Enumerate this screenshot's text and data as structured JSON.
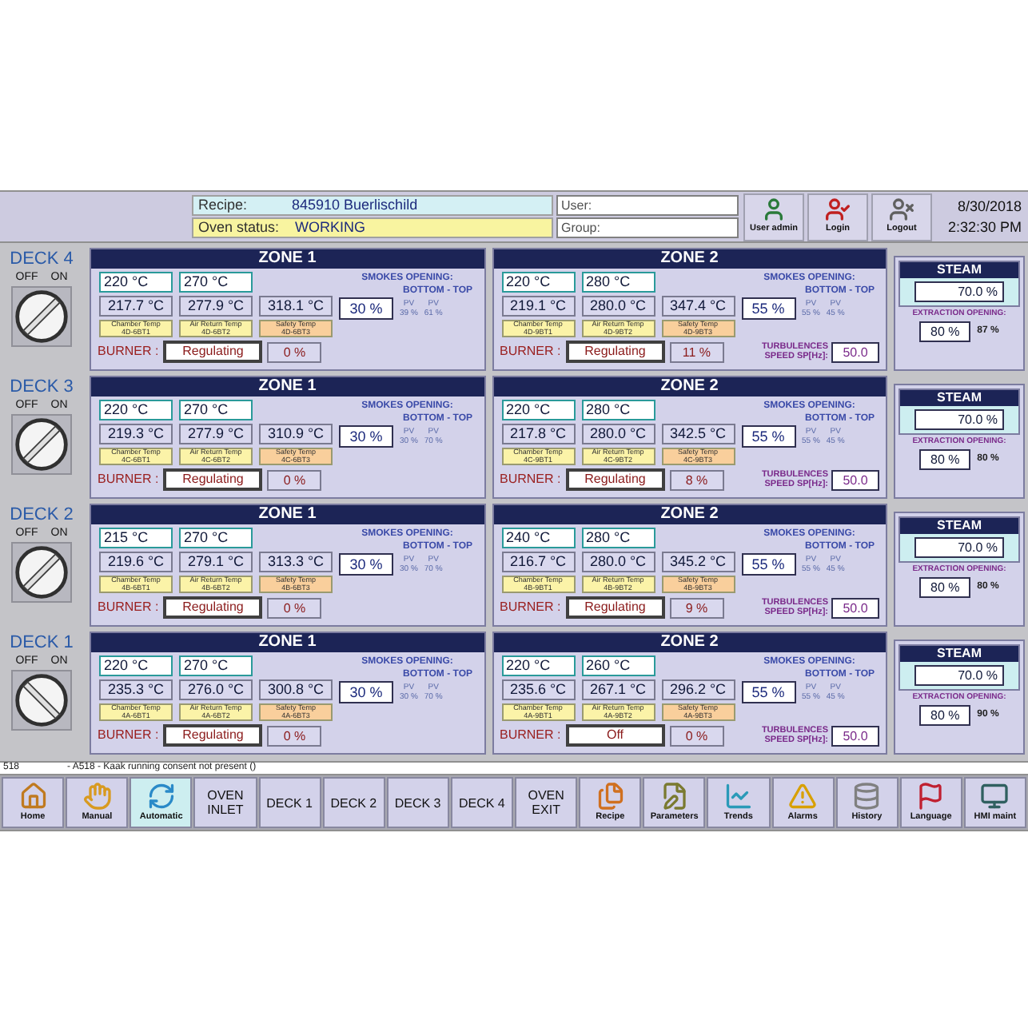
{
  "header": {
    "recipe_label": "Recipe:",
    "recipe": "845910 Buerlischild",
    "status_label": "Oven status:",
    "status": "WORKING",
    "user_label": "User:",
    "group_label": "Group:",
    "buttons": [
      {
        "kind": "user",
        "label": "User admin"
      },
      {
        "kind": "login",
        "label": "Login"
      },
      {
        "kind": "logout",
        "label": "Logout"
      }
    ],
    "date": "8/30/2018",
    "time": "2:32:30 PM"
  },
  "decks": [
    {
      "label": "DECK 4",
      "off_label": "OFF",
      "on_label": "ON",
      "on": true,
      "zones": [
        {
          "title": "ZONE 1",
          "setpoints": [
            "220 °C",
            "270 °C"
          ],
          "actuals": [
            "217.7 °C",
            "277.9 °C",
            "318.1 °C"
          ],
          "sensors": [
            {
              "name": "Chamber Temp",
              "tag": "4D-6BT1",
              "kind": "process"
            },
            {
              "name": "Air Return Temp",
              "tag": "4D-6BT2",
              "kind": "process"
            },
            {
              "name": "Safety Temp",
              "tag": "4D-6BT3",
              "kind": "safety"
            }
          ],
          "smokes_label": "SMOKES OPENING:",
          "bottom_top": "BOTTOM - TOP",
          "smoke_sp": "30 %",
          "pv_labels": [
            "PV",
            "PV"
          ],
          "pv_values": [
            "39 %",
            "61 %"
          ],
          "burner_label": "BURNER :",
          "burner_state": "Regulating",
          "burner_pct": "0 %"
        },
        {
          "title": "ZONE 2",
          "setpoints": [
            "220 °C",
            "280 °C"
          ],
          "actuals": [
            "219.1 °C",
            "280.0 °C",
            "347.4 °C"
          ],
          "sensors": [
            {
              "name": "Chamber Temp",
              "tag": "4D-9BT1",
              "kind": "process"
            },
            {
              "name": "Air Return Temp",
              "tag": "4D-9BT2",
              "kind": "process"
            },
            {
              "name": "Safety Temp",
              "tag": "4D-9BT3",
              "kind": "safety"
            }
          ],
          "smokes_label": "SMOKES OPENING:",
          "bottom_top": "BOTTOM - TOP",
          "smoke_sp": "55 %",
          "pv_labels": [
            "PV",
            "PV"
          ],
          "pv_values": [
            "55 %",
            "45 %"
          ],
          "burner_label": "BURNER :",
          "burner_state": "Regulating",
          "burner_pct": "11 %",
          "turbulence_label": [
            "TURBULENCES",
            "SPEED SP[Hz]:"
          ],
          "turbulence": "50.0"
        }
      ],
      "steam": {
        "title": "STEAM",
        "value": "70.0 %",
        "extraction_label": "EXTRACTION OPENING:",
        "extraction_sp": "80 %",
        "extraction_pv": "87 %"
      }
    },
    {
      "label": "DECK 3",
      "off_label": "OFF",
      "on_label": "ON",
      "on": true,
      "zones": [
        {
          "title": "ZONE 1",
          "setpoints": [
            "220 °C",
            "270 °C"
          ],
          "actuals": [
            "219.3 °C",
            "277.9 °C",
            "310.9 °C"
          ],
          "sensors": [
            {
              "name": "Chamber Temp",
              "tag": "4C-6BT1",
              "kind": "process"
            },
            {
              "name": "Air Return Temp",
              "tag": "4C-6BT2",
              "kind": "process"
            },
            {
              "name": "Safety Temp",
              "tag": "4C-6BT3",
              "kind": "safety"
            }
          ],
          "smokes_label": "SMOKES OPENING:",
          "bottom_top": "BOTTOM - TOP",
          "smoke_sp": "30 %",
          "pv_labels": [
            "PV",
            "PV"
          ],
          "pv_values": [
            "30 %",
            "70 %"
          ],
          "burner_label": "BURNER :",
          "burner_state": "Regulating",
          "burner_pct": "0 %"
        },
        {
          "title": "ZONE 2",
          "setpoints": [
            "220 °C",
            "280 °C"
          ],
          "actuals": [
            "217.8 °C",
            "280.0 °C",
            "342.5 °C"
          ],
          "sensors": [
            {
              "name": "Chamber Temp",
              "tag": "4C-9BT1",
              "kind": "process"
            },
            {
              "name": "Air Return Temp",
              "tag": "4C-9BT2",
              "kind": "process"
            },
            {
              "name": "Safety Temp",
              "tag": "4C-9BT3",
              "kind": "safety"
            }
          ],
          "smokes_label": "SMOKES OPENING:",
          "bottom_top": "BOTTOM - TOP",
          "smoke_sp": "55 %",
          "pv_labels": [
            "PV",
            "PV"
          ],
          "pv_values": [
            "55 %",
            "45 %"
          ],
          "burner_label": "BURNER :",
          "burner_state": "Regulating",
          "burner_pct": "8 %",
          "turbulence_label": [
            "TURBULENCES",
            "SPEED SP[Hz]:"
          ],
          "turbulence": "50.0"
        }
      ],
      "steam": {
        "title": "STEAM",
        "value": "70.0 %",
        "extraction_label": "EXTRACTION OPENING:",
        "extraction_sp": "80 %",
        "extraction_pv": "80 %"
      }
    },
    {
      "label": "DECK 2",
      "off_label": "OFF",
      "on_label": "ON",
      "on": true,
      "zones": [
        {
          "title": "ZONE 1",
          "setpoints": [
            "215 °C",
            "270 °C"
          ],
          "actuals": [
            "219.6 °C",
            "279.1 °C",
            "313.3 °C"
          ],
          "sensors": [
            {
              "name": "Chamber Temp",
              "tag": "4B-6BT1",
              "kind": "process"
            },
            {
              "name": "Air Return Temp",
              "tag": "4B-6BT2",
              "kind": "process"
            },
            {
              "name": "Safety Temp",
              "tag": "4B-6BT3",
              "kind": "safety"
            }
          ],
          "smokes_label": "SMOKES OPENING:",
          "bottom_top": "BOTTOM - TOP",
          "smoke_sp": "30 %",
          "pv_labels": [
            "PV",
            "PV"
          ],
          "pv_values": [
            "30 %",
            "70 %"
          ],
          "burner_label": "BURNER :",
          "burner_state": "Regulating",
          "burner_pct": "0 %"
        },
        {
          "title": "ZONE 2",
          "setpoints": [
            "240 °C",
            "280 °C"
          ],
          "actuals": [
            "216.7 °C",
            "280.0 °C",
            "345.2 °C"
          ],
          "sensors": [
            {
              "name": "Chamber Temp",
              "tag": "4B-9BT1",
              "kind": "process"
            },
            {
              "name": "Air Return Temp",
              "tag": "4B-9BT2",
              "kind": "process"
            },
            {
              "name": "Safety Temp",
              "tag": "4B-9BT3",
              "kind": "safety"
            }
          ],
          "smokes_label": "SMOKES OPENING:",
          "bottom_top": "BOTTOM - TOP",
          "smoke_sp": "55 %",
          "pv_labels": [
            "PV",
            "PV"
          ],
          "pv_values": [
            "55 %",
            "45 %"
          ],
          "burner_label": "BURNER :",
          "burner_state": "Regulating",
          "burner_pct": "9 %",
          "turbulence_label": [
            "TURBULENCES",
            "SPEED SP[Hz]:"
          ],
          "turbulence": "50.0"
        }
      ],
      "steam": {
        "title": "STEAM",
        "value": "70.0 %",
        "extraction_label": "EXTRACTION OPENING:",
        "extraction_sp": "80 %",
        "extraction_pv": "80 %"
      }
    },
    {
      "label": "DECK 1",
      "off_label": "OFF",
      "on_label": "ON",
      "on": false,
      "zones": [
        {
          "title": "ZONE 1",
          "setpoints": [
            "220 °C",
            "270 °C"
          ],
          "actuals": [
            "235.3 °C",
            "276.0 °C",
            "300.8 °C"
          ],
          "sensors": [
            {
              "name": "Chamber Temp",
              "tag": "4A-6BT1",
              "kind": "process"
            },
            {
              "name": "Air Return Temp",
              "tag": "4A-6BT2",
              "kind": "process"
            },
            {
              "name": "Safety Temp",
              "tag": "4A-6BT3",
              "kind": "safety"
            }
          ],
          "smokes_label": "SMOKES OPENING:",
          "bottom_top": "BOTTOM - TOP",
          "smoke_sp": "30 %",
          "pv_labels": [
            "PV",
            "PV"
          ],
          "pv_values": [
            "30 %",
            "70 %"
          ],
          "burner_label": "BURNER :",
          "burner_state": "Regulating",
          "burner_pct": "0 %"
        },
        {
          "title": "ZONE 2",
          "setpoints": [
            "220 °C",
            "260 °C"
          ],
          "actuals": [
            "235.6 °C",
            "267.1 °C",
            "296.2 °C"
          ],
          "sensors": [
            {
              "name": "Chamber Temp",
              "tag": "4A-9BT1",
              "kind": "process"
            },
            {
              "name": "Air Return Temp",
              "tag": "4A-9BT2",
              "kind": "process"
            },
            {
              "name": "Safety Temp",
              "tag": "4A-9BT3",
              "kind": "safety"
            }
          ],
          "smokes_label": "SMOKES OPENING:",
          "bottom_top": "BOTTOM - TOP",
          "smoke_sp": "55 %",
          "pv_labels": [
            "PV",
            "PV"
          ],
          "pv_values": [
            "55 %",
            "45 %"
          ],
          "burner_label": "BURNER :",
          "burner_state": "Off",
          "burner_pct": "0 %",
          "turbulence_label": [
            "TURBULENCES",
            "SPEED SP[Hz]:"
          ],
          "turbulence": "50.0"
        }
      ],
      "steam": {
        "title": "STEAM",
        "value": "70.0 %",
        "extraction_label": "EXTRACTION OPENING:",
        "extraction_sp": "80 %",
        "extraction_pv": "90 %"
      }
    }
  ],
  "alarm_line": {
    "code": "518",
    "message": "- A518 - Kaak running consent not present ()"
  },
  "nav": [
    {
      "kind": "home",
      "label": "Home",
      "selected": false
    },
    {
      "kind": "manual",
      "label": "Manual",
      "selected": false
    },
    {
      "kind": "automatic",
      "label": "Automatic",
      "selected": true
    },
    {
      "kind": "text",
      "label": "OVEN INLET",
      "selected": false
    },
    {
      "kind": "text",
      "label": "DECK 1",
      "selected": false
    },
    {
      "kind": "text",
      "label": "DECK 2",
      "selected": false
    },
    {
      "kind": "text",
      "label": "DECK 3",
      "selected": false
    },
    {
      "kind": "text",
      "label": "DECK 4",
      "selected": false
    },
    {
      "kind": "text",
      "label": "OVEN EXIT",
      "selected": false
    },
    {
      "kind": "recipe",
      "label": "Recipe",
      "selected": false
    },
    {
      "kind": "parameters",
      "label": "Parameters",
      "selected": false
    },
    {
      "kind": "trends",
      "label": "Trends",
      "selected": false
    },
    {
      "kind": "alarms",
      "label": "Alarms",
      "selected": false
    },
    {
      "kind": "history",
      "label": "History",
      "selected": false
    },
    {
      "kind": "language",
      "label": "Language",
      "selected": false
    },
    {
      "kind": "maint",
      "label": "HMI maint",
      "selected": false
    }
  ]
}
